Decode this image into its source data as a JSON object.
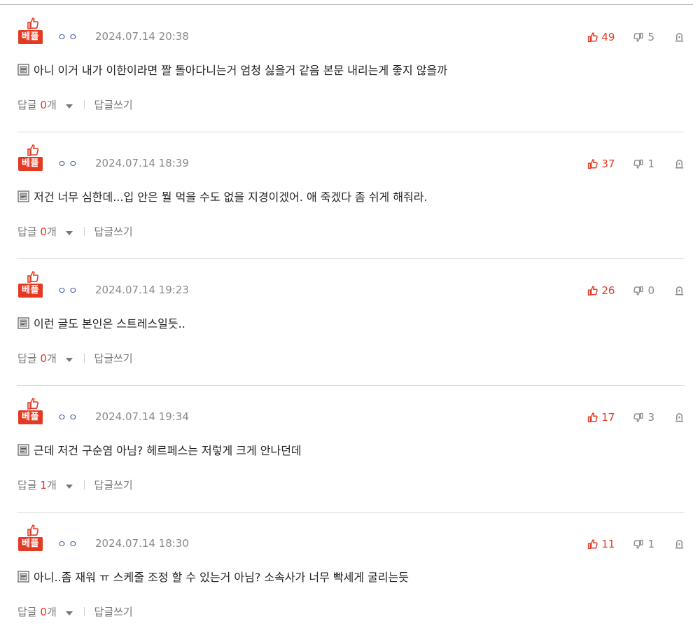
{
  "colors": {
    "accent": "#e33a24",
    "nickname": "#3c5aa8",
    "muted": "#8a8a8a"
  },
  "icons": {
    "best": "thumbs-up-icon",
    "like": "thumbs-up-icon",
    "dislike": "thumbs-down-icon",
    "report": "report-icon",
    "memo": "memo-icon",
    "expand": "caret-down-icon"
  },
  "labels": {
    "best_badge": "베플",
    "reply": "답글",
    "reply_unit": "개",
    "write_reply": "답글쓰기"
  },
  "comments": [
    {
      "nickname": "ㅇㅇ",
      "date": "2024.07.14 20:38",
      "likes": "49",
      "dislikes": "5",
      "text": "아니 이거 내가 이한이라면 짤 돌아다니는거 엄청 싫을거 같음 본문 내리는게 좋지 않을까",
      "replies": "0"
    },
    {
      "nickname": "ㅇㅇ",
      "date": "2024.07.14 18:39",
      "likes": "37",
      "dislikes": "1",
      "text": "저건 너무 심한데...입 안은 뭘 먹을 수도 없을 지경이겠어. 애 죽겠다 좀 쉬게 해줘라.",
      "replies": "0"
    },
    {
      "nickname": "ㅇㅇ",
      "date": "2024.07.14 19:23",
      "likes": "26",
      "dislikes": "0",
      "text": "이런 글도 본인은 스트레스일듯..",
      "replies": "0"
    },
    {
      "nickname": "ㅇㅇ",
      "date": "2024.07.14 19:34",
      "likes": "17",
      "dislikes": "3",
      "text": "근데 저건 구순염 아님? 헤르페스는 저렇게 크게 안나던데",
      "replies": "1"
    },
    {
      "nickname": "ㅇㅇ",
      "date": "2024.07.14 18:30",
      "likes": "11",
      "dislikes": "1",
      "text": "아니..좀 재워 ㅠ 스케줄 조정 할 수 있는거 아님? 소속사가 너무 빡세게 굴리는듯",
      "replies": "0"
    }
  ]
}
